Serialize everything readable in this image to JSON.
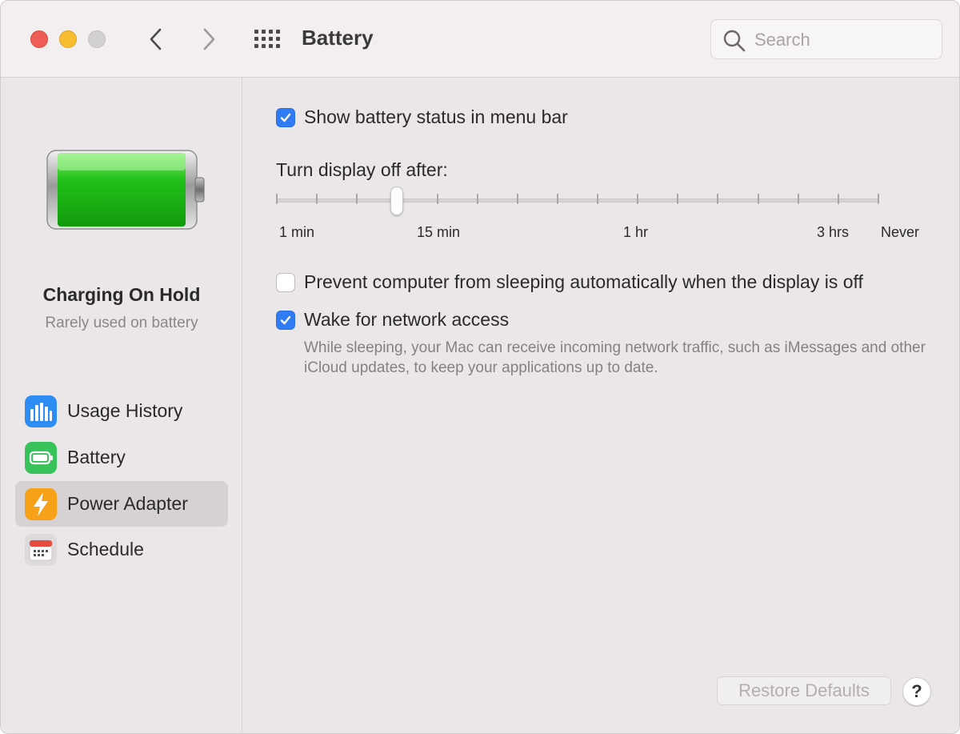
{
  "window": {
    "title": "Battery",
    "search_placeholder": "Search"
  },
  "icons": {
    "back": "chevron-left-icon",
    "forward": "chevron-right-icon",
    "show_all": "grid-icon",
    "search": "search-icon"
  },
  "sidebar": {
    "status_title": "Charging On Hold",
    "status_subtitle": "Rarely used on battery",
    "battery_level": 1.0,
    "items": [
      {
        "label": "Usage History",
        "icon": "bar-chart-icon",
        "color": "#2e8cf5",
        "selected": false
      },
      {
        "label": "Battery",
        "icon": "battery-icon",
        "color": "#38c25a",
        "selected": false
      },
      {
        "label": "Power Adapter",
        "icon": "lightning-bolt-icon",
        "color": "#f6a118",
        "selected": true
      },
      {
        "label": "Schedule",
        "icon": "calendar-icon",
        "color": "#e84a3f",
        "selected": false
      }
    ]
  },
  "main": {
    "show_status": {
      "label": "Show battery status in menu bar",
      "checked": true
    },
    "display_off": {
      "label": "Turn display off after:",
      "tick_labels": [
        "1 min",
        "15 min",
        "1 hr",
        "3 hrs",
        "Never"
      ],
      "tick_count": 16,
      "selected_index": 3
    },
    "prevent_sleep": {
      "label": "Prevent computer from sleeping automatically when the display is off",
      "checked": false
    },
    "wake_network": {
      "label": "Wake for network access",
      "checked": true
    },
    "wake_help": "While sleeping, your Mac can receive incoming network traffic, such as iMessages and other iCloud updates, to keep your applications up to date.",
    "restore_defaults": "Restore Defaults",
    "help": "?"
  },
  "colors": {
    "accent": "#2f7cf6",
    "battery_green": "#22c21a",
    "close": "#ee5d56",
    "minimize": "#f5bd2f",
    "zoom_disabled": "#d3d0d1"
  }
}
